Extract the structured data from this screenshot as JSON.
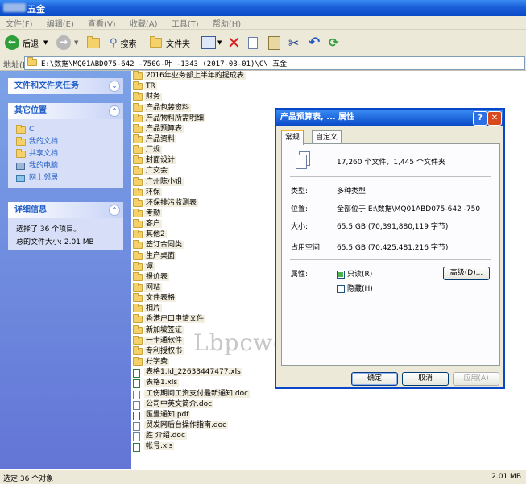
{
  "window": {
    "title": "五金"
  },
  "menu": [
    "文件(F)",
    "编辑(E)",
    "查看(V)",
    "收藏(A)",
    "工具(T)",
    "帮助(H)"
  ],
  "toolbar": {
    "back_label": "后退",
    "search_label": "搜索",
    "folders_label": "文件夹"
  },
  "address": {
    "label": "地址(D)",
    "path": "E:\\数据\\MQ01ABD075-642      -750G-叶     -1343       (2017-03-01)\\C\\    五金"
  },
  "tasks": {
    "file_tasks_header": "文件和文件夹任务",
    "other_places_header": "其它位置",
    "other_places": [
      "C",
      "我的文档",
      "共享文档",
      "我的电脑",
      "网上邻居"
    ],
    "details_header": "详细信息",
    "details_line1": "选择了 36 个项目。",
    "details_line2": "总的文件大小: 2.01 MB"
  },
  "files": [
    {
      "name": "2016年业务部上半年的提成表",
      "type": "folder"
    },
    {
      "name": "TR",
      "type": "folder"
    },
    {
      "name": "财务",
      "type": "folder"
    },
    {
      "name": "产品包装资料",
      "type": "folder"
    },
    {
      "name": "产品物料所需明细",
      "type": "folder"
    },
    {
      "name": "产品预算表",
      "type": "folder"
    },
    {
      "name": "产品资料",
      "type": "folder"
    },
    {
      "name": "厂规",
      "type": "folder"
    },
    {
      "name": "封面设计",
      "type": "folder"
    },
    {
      "name": "广交会",
      "type": "folder"
    },
    {
      "name": "广州陈小姐",
      "type": "folder"
    },
    {
      "name": "环保",
      "type": "folder"
    },
    {
      "name": "环保排污监测表",
      "type": "folder"
    },
    {
      "name": "考勤",
      "type": "folder"
    },
    {
      "name": "客户",
      "type": "folder"
    },
    {
      "name": "其他2",
      "type": "folder"
    },
    {
      "name": "签订合同类",
      "type": "folder"
    },
    {
      "name": "生产桌面",
      "type": "folder"
    },
    {
      "name": "谭",
      "type": "folder"
    },
    {
      "name": "报价表",
      "type": "folder"
    },
    {
      "name": "网站",
      "type": "folder"
    },
    {
      "name": "文件表格",
      "type": "folder"
    },
    {
      "name": "相片",
      "type": "folder"
    },
    {
      "name": "香港户口申请文件",
      "type": "folder"
    },
    {
      "name": "新加坡签证",
      "type": "folder"
    },
    {
      "name": "一卡通软件",
      "type": "folder"
    },
    {
      "name": "专利授权书",
      "type": "folder"
    },
    {
      "name": "孖学费",
      "type": "folder"
    },
    {
      "name": "表格1.Id_22633447477.xls",
      "type": "xls"
    },
    {
      "name": "表格1.xls",
      "type": "xls"
    },
    {
      "name": "工伤期间工资支付最新通知.doc",
      "type": "doc"
    },
    {
      "name": "公司中英文简介.doc",
      "type": "doc"
    },
    {
      "name": "匯豐通知.pdf",
      "type": "pdf"
    },
    {
      "name": "贸发网后台操作指南.doc",
      "type": "doc"
    },
    {
      "name": "胜    介绍.doc",
      "type": "doc"
    },
    {
      "name": "帐号.xls",
      "type": "xls"
    }
  ],
  "watermark": "Lbpcwd原版图片",
  "status": {
    "left": "选定 36 个对象",
    "right": "2.01 MB"
  },
  "dialog": {
    "title": "产品预算表, ... 属性",
    "tabs": [
      "常规",
      "自定义"
    ],
    "summary": "17,260 个文件，1,445 个文件夹",
    "type_label": "类型:",
    "type_value": "多种类型",
    "location_label": "位置:",
    "location_value": "全部位于 E:\\数据\\MQ01ABD075-642      -750",
    "size_label": "大小:",
    "size_value": "65.5 GB (70,391,880,119 字节)",
    "disk_label": "占用空间:",
    "disk_value": "65.5 GB (70,425,481,216 字节)",
    "attr_label": "属性:",
    "readonly_label": "只读(R)",
    "hidden_label": "隐藏(H)",
    "advanced_label": "高级(D)...",
    "ok_label": "确定",
    "cancel_label": "取消",
    "apply_label": "应用(A)",
    "help_glyph": "?",
    "close_glyph": "✕"
  },
  "colors": {
    "xp_blue": "#0a4ac8",
    "task_link": "#215dc6",
    "pane_bg": "#7ba2e7"
  }
}
